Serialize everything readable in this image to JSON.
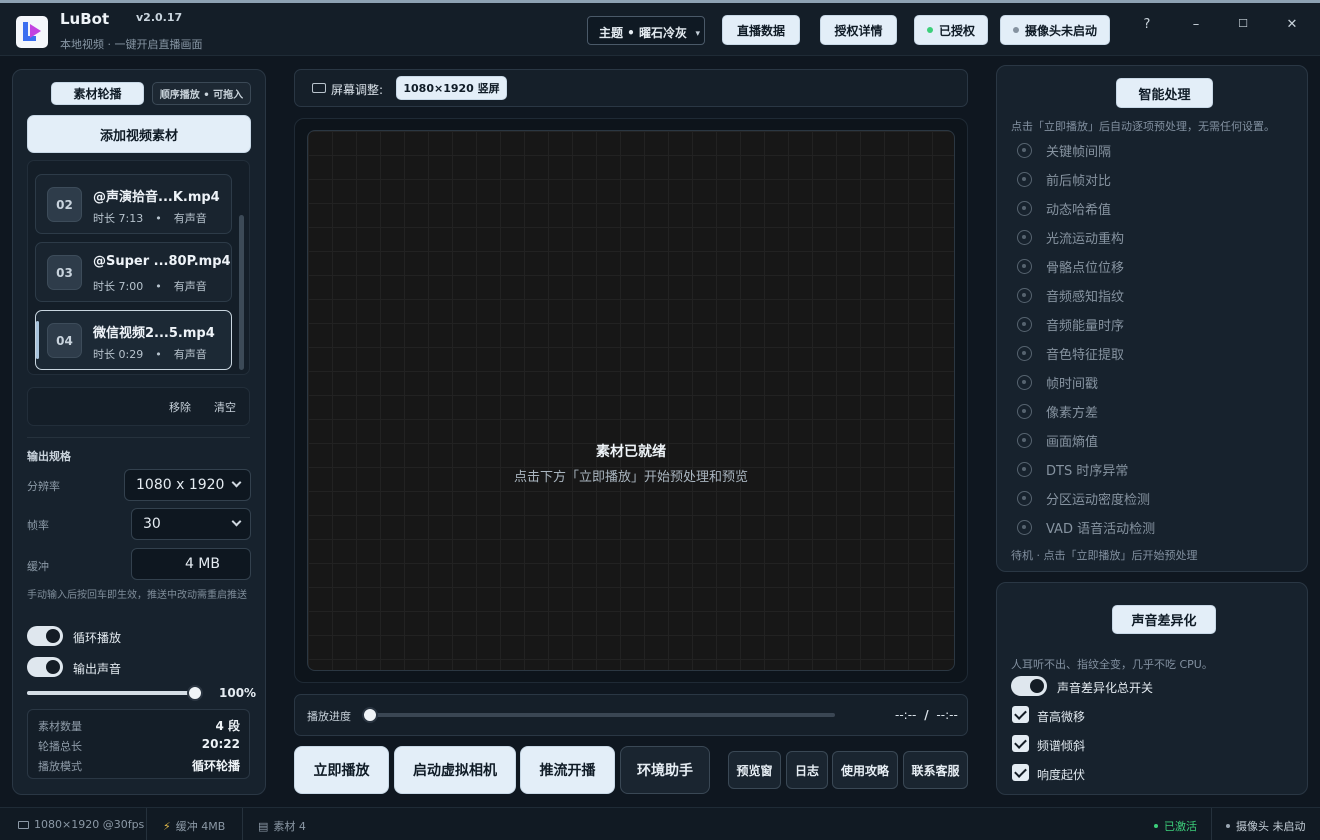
{
  "app": {
    "name": "LuBot",
    "version": "v2.0.17",
    "subtitle": "本地视频 · 一键开启直播画面"
  },
  "header": {
    "theme_select": "主题 • 曜石冷灰",
    "buttons": {
      "live_data": "直播数据",
      "license_details": "授权详情",
      "licensed": "已授权",
      "camera_status": "摄像头未启动"
    },
    "help": "?",
    "minimize": "–",
    "maximize": "☐",
    "close": "✕"
  },
  "left": {
    "tab_active": "素材轮播",
    "tab_hint": "顺序播放 • 可拖入",
    "add_button": "添加视频素材",
    "items": [
      {
        "num": "02",
        "name": "@声演拾音...K.mp4",
        "duration": "时长 7:13",
        "audio": "有声音"
      },
      {
        "num": "03",
        "name": "@Super ...80P.mp4",
        "duration": "时长 7:00",
        "audio": "有声音"
      },
      {
        "num": "04",
        "name": "微信视频2...5.mp4",
        "duration": "时长 0:29",
        "audio": "有声音"
      }
    ],
    "remove": "移除",
    "clear": "清空",
    "output_title": "输出规格",
    "resolution_label": "分辨率",
    "resolution_value": "1080 x 1920",
    "fps_label": "帧率",
    "fps_value": "30",
    "buffer_label": "缓冲",
    "buffer_value": "4 MB",
    "note": "手动输入后按回车即生效，推送中改动需重启推送",
    "loop_label": "循环播放",
    "audio_label": "输出声音",
    "volume_percent": "100%",
    "volume_fraction": 1.0,
    "stats": [
      {
        "label": "素材数量",
        "value": "4 段"
      },
      {
        "label": "轮播总长",
        "value": "20:22"
      },
      {
        "label": "播放模式",
        "value": "循环轮播"
      }
    ]
  },
  "center": {
    "screen_label": "屏幕调整:",
    "screen_value": "1080×1920 竖屏",
    "ready_title": "素材已就绪",
    "ready_sub": "点击下方「立即播放」开始预处理和预览",
    "progress_label": "播放进度",
    "progress_fraction": 0.0,
    "time_current": "--:--",
    "time_sep": "/",
    "time_total": "--:--",
    "buttons": {
      "play_now": "立即播放",
      "virtual_cam": "启动虚拟相机",
      "stream": "推流开播",
      "env_helper": "环境助手",
      "preview": "预览窗",
      "log": "日志",
      "guide": "使用攻略",
      "support": "联系客服"
    }
  },
  "right": {
    "smart_title": "智能处理",
    "smart_desc": "点击「立即播放」后自动逐项预处理，无需任何设置。",
    "processes": [
      "关键帧间隔",
      "前后帧对比",
      "动态哈希值",
      "光流运动重构",
      "骨骼点位位移",
      "音频感知指纹",
      "音频能量时序",
      "音色特征提取",
      "帧时间戳",
      "像素方差",
      "画面熵值",
      "DTS 时序异常",
      "分区运动密度检测",
      "VAD 语音活动检测"
    ],
    "smart_status": "待机 · 点击「立即播放」后开始预处理",
    "audio_title": "声音差异化",
    "audio_desc": "人耳听不出、指纹全变，几乎不吃 CPU。",
    "audio_master": "声音差异化总开关",
    "checks": [
      "音高微移",
      "频谱倾斜",
      "响度起伏"
    ]
  },
  "statusbar": {
    "res": "1080×1920 @30fps",
    "buffer": "缓冲 4MB",
    "materials": "素材 4",
    "activated": "已激活",
    "camera": "摄像头 未启动"
  },
  "colors": {
    "accent_green": "#3ccf7a",
    "camera_gray": "#9aa6b2",
    "background": "#0f1720"
  }
}
